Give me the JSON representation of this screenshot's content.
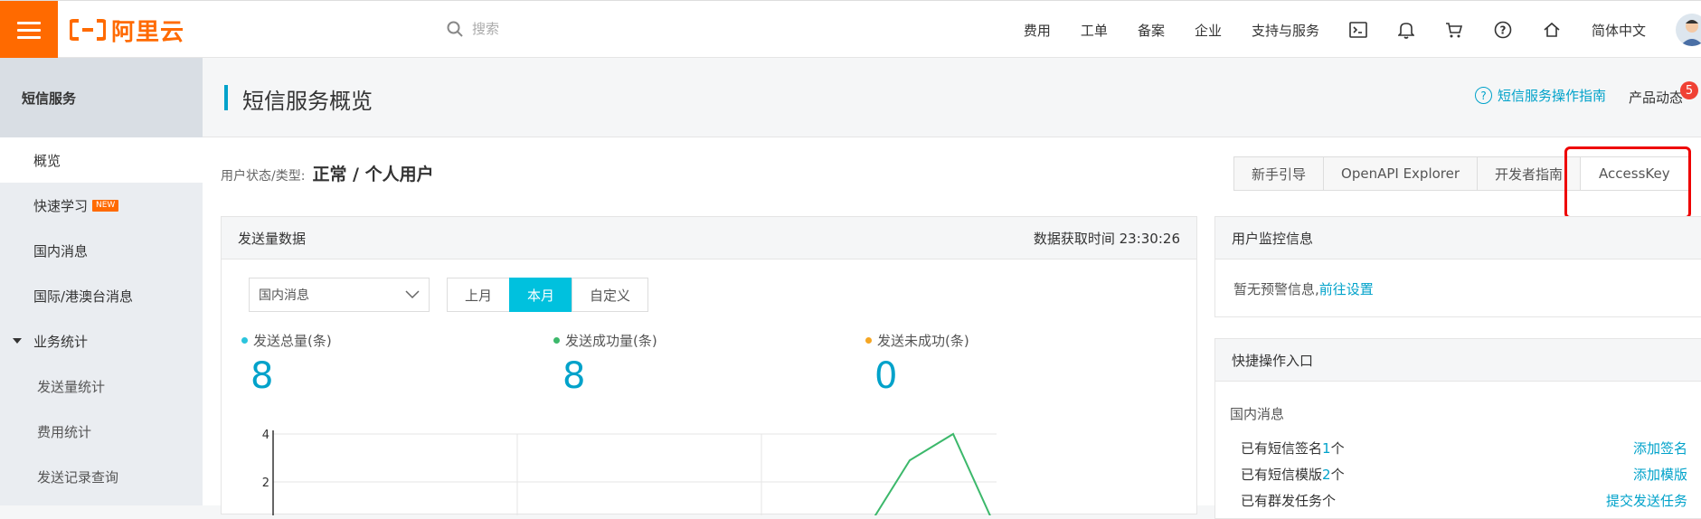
{
  "topbar": {
    "logo_text": "阿里云",
    "search_placeholder": "搜索",
    "nav": [
      "费用",
      "工单",
      "备案",
      "企业",
      "支持与服务"
    ],
    "language": "简体中文"
  },
  "sidebar": {
    "title": "短信服务",
    "items": [
      {
        "label": "概览"
      },
      {
        "label": "快速学习",
        "badge": "NEW"
      },
      {
        "label": "国内消息"
      },
      {
        "label": "国际/港澳台消息"
      },
      {
        "label": "业务统计"
      },
      {
        "label": "发送量统计"
      },
      {
        "label": "费用统计"
      },
      {
        "label": "发送记录查询"
      }
    ]
  },
  "header": {
    "title": "短信服务概览",
    "guide_link": "短信服务操作指南",
    "news": "产品动态",
    "news_count": "5"
  },
  "status": {
    "label": "用户状态/类型:",
    "value": "正常 / 个人用户"
  },
  "buttons": [
    "新手引导",
    "OpenAPI Explorer",
    "开发者指南",
    "AccessKey"
  ],
  "send_panel": {
    "title": "发送量数据",
    "fetch_time": "数据获取时间 23:30:26",
    "select_value": "国内消息",
    "ranges": [
      "上月",
      "本月",
      "自定义"
    ],
    "active_range": "本月",
    "stats": [
      {
        "label": "发送总量(条)",
        "value": "8",
        "color": "#2bc4dd"
      },
      {
        "label": "发送成功量(条)",
        "value": "8",
        "color": "#3cb86b"
      },
      {
        "label": "发送未成功(条)",
        "value": "0",
        "color": "#f5a623"
      }
    ]
  },
  "chart_data": {
    "type": "line",
    "ytick_labels": [
      "4",
      "2"
    ],
    "ylim": [
      0,
      4
    ],
    "grid": true,
    "series": [
      {
        "color": "#3cb86b",
        "points": [
          [
            0.0,
            0
          ],
          [
            0.2,
            0
          ],
          [
            0.4,
            0
          ],
          [
            0.6,
            0
          ],
          [
            0.82,
            0
          ],
          [
            0.88,
            2.9
          ],
          [
            0.94,
            4
          ],
          [
            1.0,
            0
          ]
        ]
      }
    ]
  },
  "monitor_panel": {
    "title": "用户监控信息",
    "text": "暂无预警信息,",
    "link": "前往设置"
  },
  "quick_panel": {
    "title": "快捷操作入口",
    "section": "国内消息",
    "rows": [
      {
        "prefix": "已有短信签名",
        "num": "1",
        "suffix": "个",
        "action": "添加签名"
      },
      {
        "prefix": "已有短信模版",
        "num": "2",
        "suffix": "个",
        "action": "添加模版"
      },
      {
        "prefix": "已有群发任务",
        "num": "",
        "suffix": "个",
        "action": "提交发送任务"
      }
    ]
  }
}
